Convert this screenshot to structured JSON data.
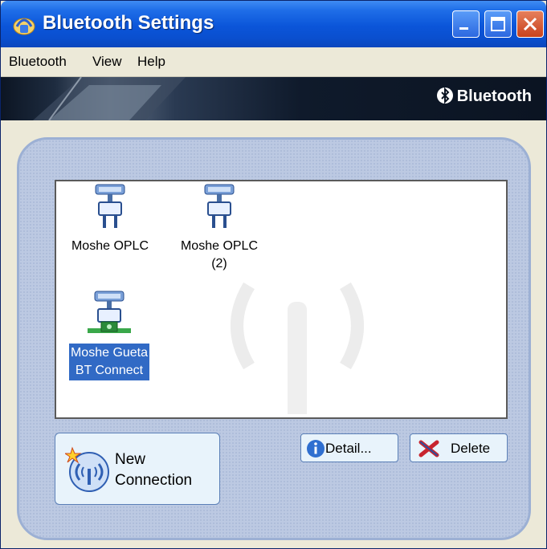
{
  "window": {
    "title": "Bluetooth Settings"
  },
  "menu": {
    "items": [
      "Bluetooth",
      "View",
      "Help"
    ]
  },
  "banner": {
    "brand": "Bluetooth"
  },
  "devices": [
    {
      "label_lines": [
        "Moshe OPLC"
      ],
      "icon": "serial-port-icon"
    },
    {
      "label_lines": [
        "Moshe OPLC",
        "(2)"
      ],
      "icon": "serial-port-icon"
    },
    {
      "label_lines": [
        "Moshe Gueta",
        "BT Connect"
      ],
      "icon": "connected-serial-port-icon",
      "selected": true
    }
  ],
  "buttons": {
    "new_connection": [
      "New",
      "Connection"
    ],
    "detail": "Detail...",
    "delete": "Delete"
  },
  "colors": {
    "titlebar": "#0b55d9",
    "selection": "#316ac5",
    "panel": "#bcc9e2"
  }
}
